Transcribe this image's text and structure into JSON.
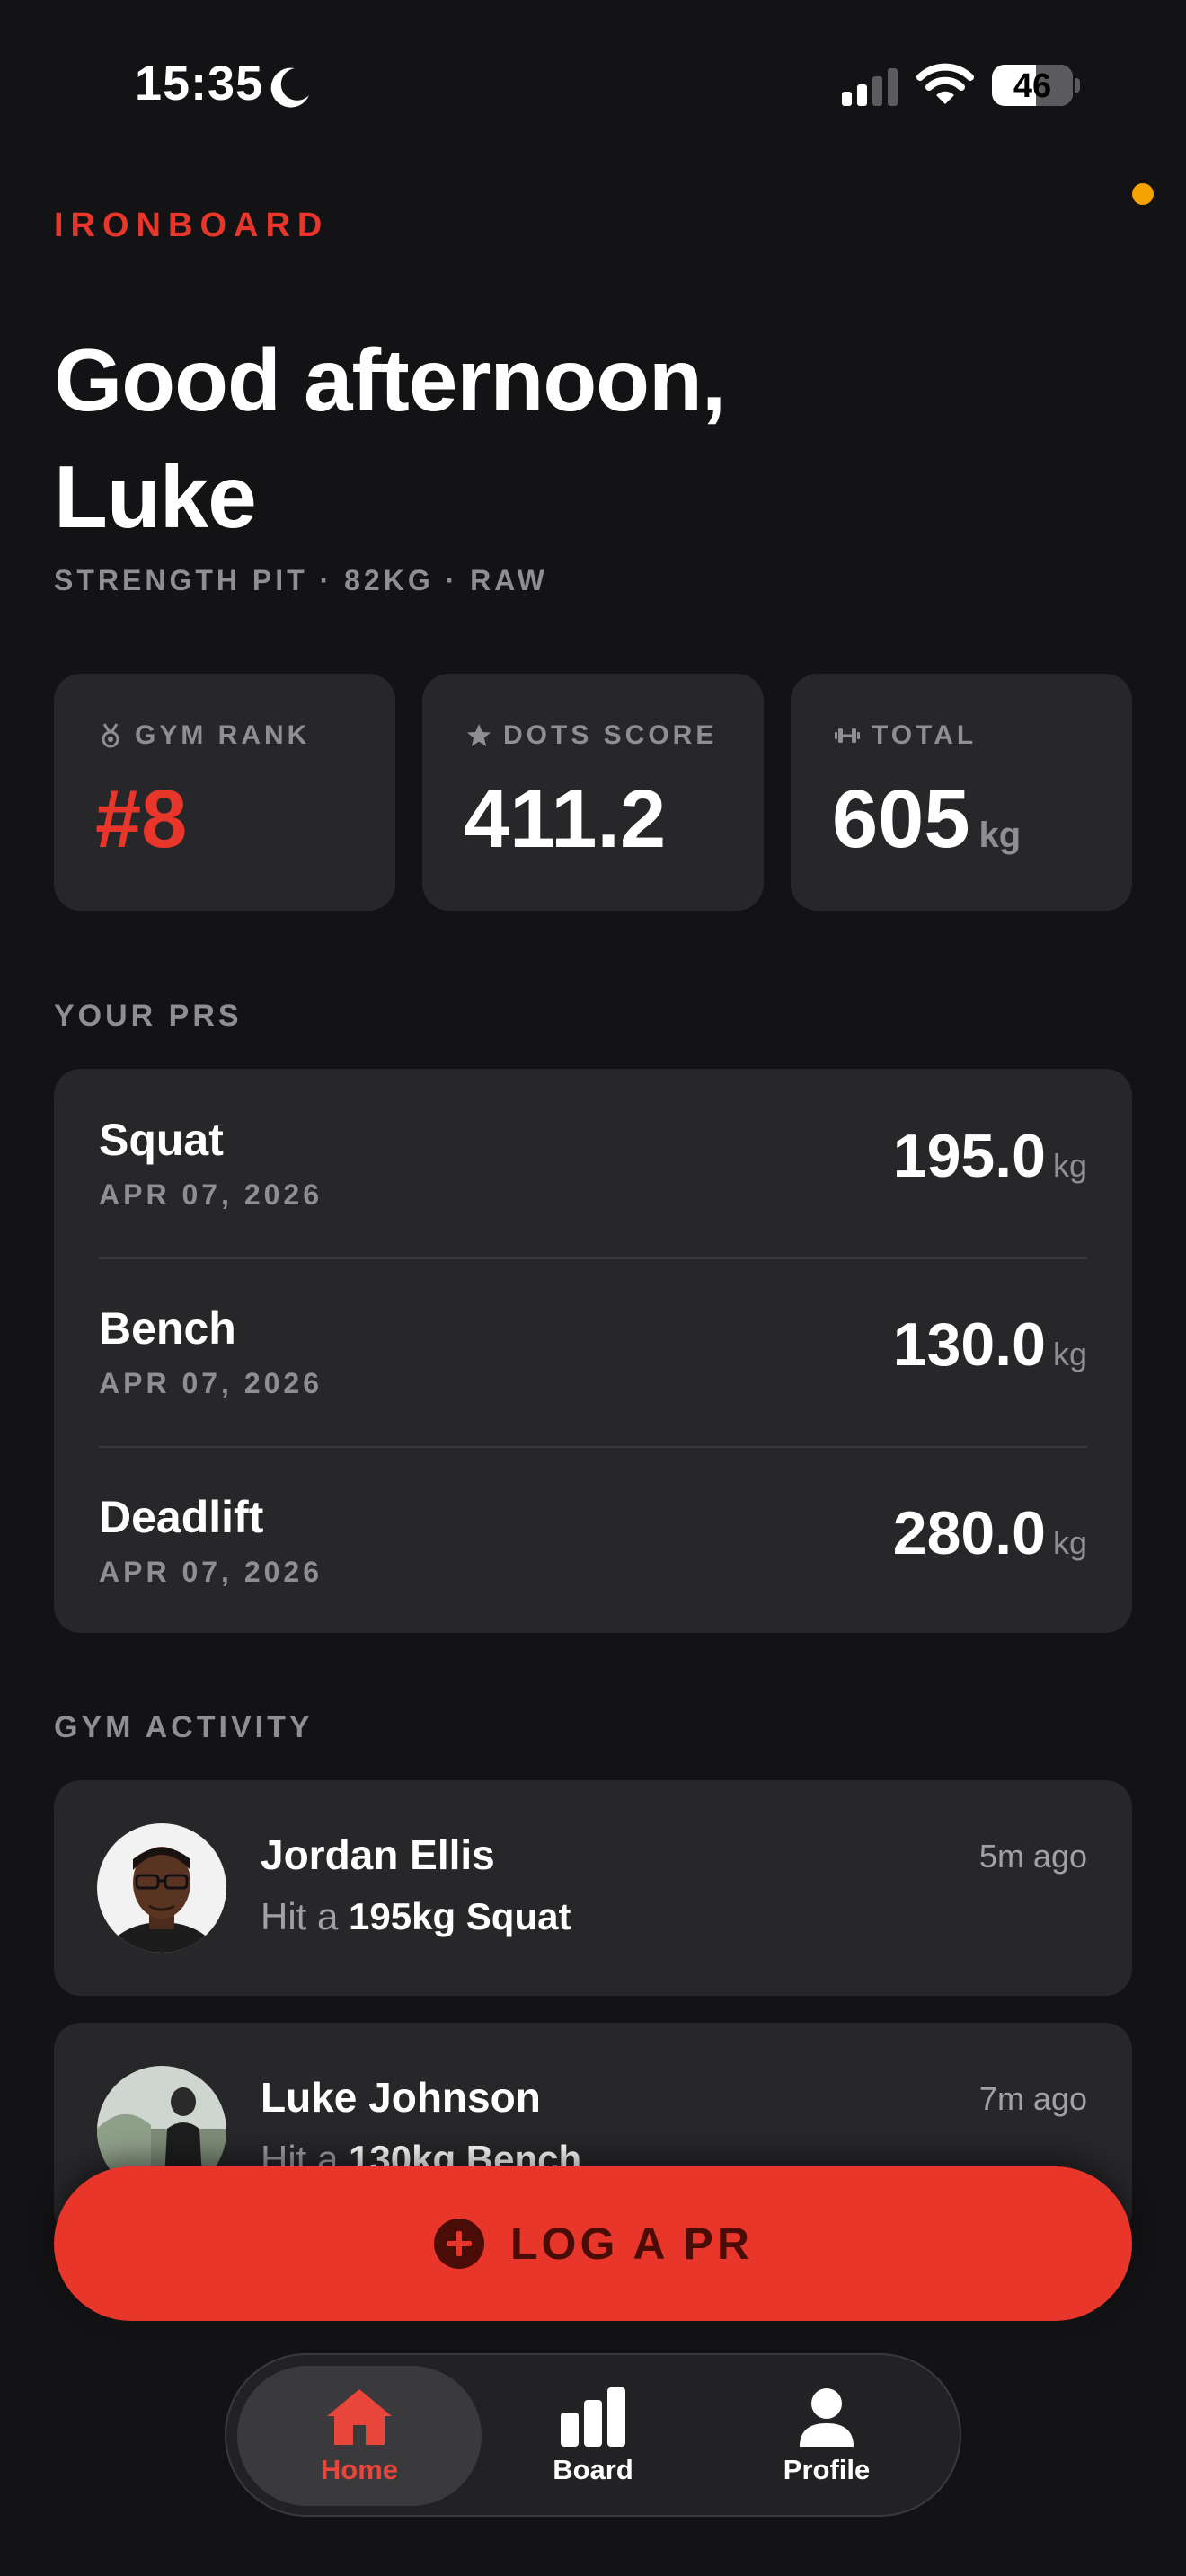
{
  "status_bar": {
    "time": "15:35",
    "battery": "46"
  },
  "header": {
    "brand": "IRONBOARD",
    "greeting": "Good afternoon, Luke",
    "subline": "STRENGTH PIT · 82KG · RAW"
  },
  "stats": [
    {
      "label": "GYM RANK",
      "icon": "medal-icon",
      "value": "#8",
      "unit": ""
    },
    {
      "label": "DOTS SCORE",
      "icon": "star-icon",
      "value": "411.2",
      "unit": ""
    },
    {
      "label": "TOTAL",
      "icon": "dumbbell-icon",
      "value": "605",
      "unit": "kg"
    }
  ],
  "prs": {
    "title": "YOUR PRS",
    "items": [
      {
        "lift": "Squat",
        "date": "APR 07, 2026",
        "value": "195.0",
        "unit": "kg"
      },
      {
        "lift": "Bench",
        "date": "APR 07, 2026",
        "value": "130.0",
        "unit": "kg"
      },
      {
        "lift": "Deadlift",
        "date": "APR 07, 2026",
        "value": "280.0",
        "unit": "kg"
      }
    ]
  },
  "activity": {
    "title": "GYM ACTIVITY",
    "items": [
      {
        "name": "Jordan Ellis",
        "prefix": "Hit a ",
        "highlight": "195kg Squat",
        "time": "5m ago"
      },
      {
        "name": "Luke Johnson",
        "prefix": "Hit a ",
        "highlight": "130kg Bench",
        "time": "7m ago"
      }
    ]
  },
  "log_button": {
    "label": "LOG A PR",
    "icon": "plus-circle-icon"
  },
  "tabs": [
    {
      "label": "Home",
      "icon": "home-icon",
      "active": true
    },
    {
      "label": "Board",
      "icon": "bar-chart-icon",
      "active": false
    },
    {
      "label": "Profile",
      "icon": "person-icon",
      "active": false
    }
  ],
  "colors": {
    "accent": "#e8362b",
    "background": "#131315",
    "card": "#27272a",
    "muted": "#8e8e93"
  }
}
